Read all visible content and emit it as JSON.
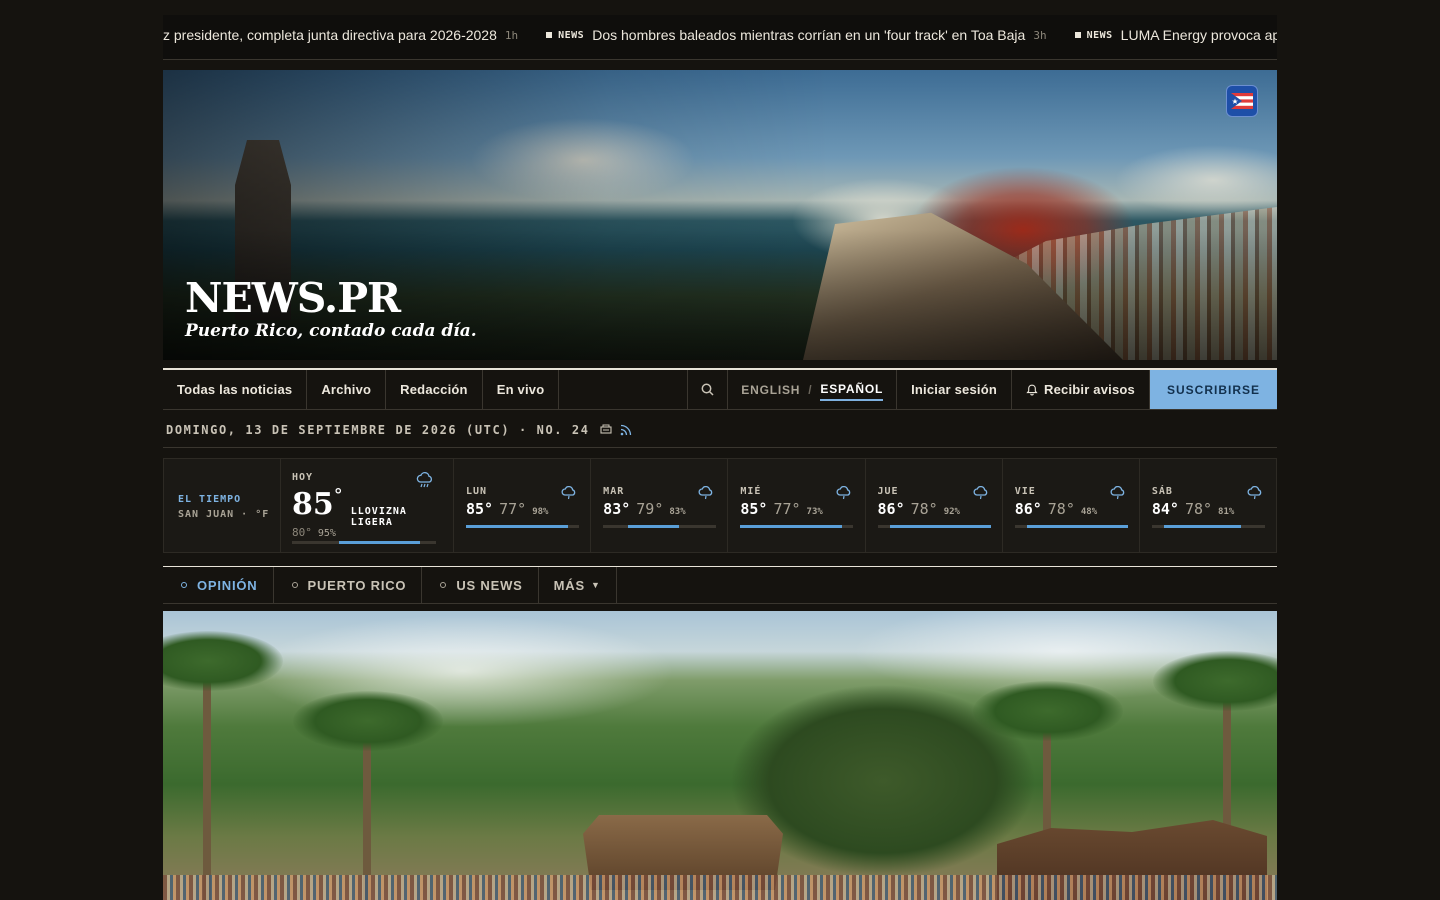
{
  "ticker": [
    {
      "tag": "",
      "headline": "z presidente, completa junta directiva para 2026-2028",
      "age": "1h"
    },
    {
      "tag": "NEWS",
      "headline": "Dos hombres baleados mientras corrían en un 'four track' en Toa Baja",
      "age": "3h"
    },
    {
      "tag": "NEWS",
      "headline": "LUMA Energy provoca apagones e",
      "age": ""
    }
  ],
  "hero": {
    "brand": "NEWS.PR",
    "tagline": "Puerto Rico, contado cada día.",
    "badge_icon": "pr-flag-icon"
  },
  "nav": {
    "links": [
      "Todas las noticias",
      "Archivo",
      "Redacción",
      "En vivo"
    ],
    "search_icon": "search-icon",
    "lang_en": "ENGLISH",
    "lang_sep": "/",
    "lang_es": "ESPAÑOL",
    "login": "Iniciar sesión",
    "alerts": "Recibir avisos",
    "subscribe": "SUSCRIBIRSE"
  },
  "dateline": {
    "text": "DOMINGO, 13 DE SEPTIEMBRE DE 2026 (UTC) · NO. 24"
  },
  "weather": {
    "label1": "EL TIEMPO",
    "label2": "SAN JUAN · °F",
    "today": {
      "label": "HOY",
      "temp": "85",
      "deg": "°",
      "condition": "LLOVIZNA LIGERA",
      "low": "80°",
      "precip": "95%",
      "precip_value": 95
    },
    "days": [
      {
        "day": "LUN",
        "hi": "85°",
        "lo": "77°",
        "precip": "98%",
        "precip_value": 98
      },
      {
        "day": "MAR",
        "hi": "83°",
        "lo": "79°",
        "precip": "83%",
        "precip_value": 83
      },
      {
        "day": "MIÉ",
        "hi": "85°",
        "lo": "77°",
        "precip": "73%",
        "precip_value": 73
      },
      {
        "day": "JUE",
        "hi": "86°",
        "lo": "78°",
        "precip": "92%",
        "precip_value": 92
      },
      {
        "day": "VIE",
        "hi": "86°",
        "lo": "78°",
        "precip": "48%",
        "precip_value": 48
      },
      {
        "day": "SÁB",
        "hi": "84°",
        "lo": "78°",
        "precip": "81%",
        "precip_value": 81
      }
    ],
    "icon": "rain-cloud-icon"
  },
  "sections": {
    "tabs": [
      "OPINIÓN",
      "PUERTO RICO",
      "US NEWS"
    ],
    "more": "MÁS",
    "active": "OPINIÓN"
  },
  "colors": {
    "accent": "#7eb3e2",
    "background": "#15130f",
    "subscribe_bg": "#7eb3e2"
  }
}
